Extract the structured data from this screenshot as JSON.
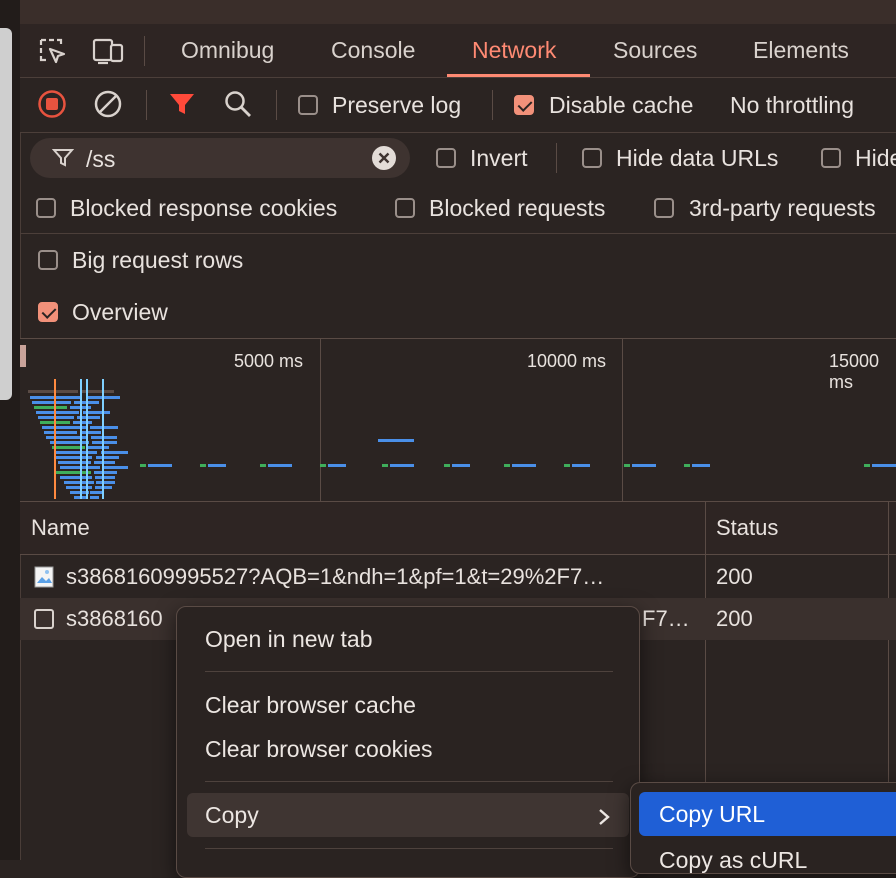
{
  "tabs": [
    {
      "label": "Omnibug",
      "active": false
    },
    {
      "label": "Console",
      "active": false
    },
    {
      "label": "Network",
      "active": true
    },
    {
      "label": "Sources",
      "active": false
    },
    {
      "label": "Elements",
      "active": false
    }
  ],
  "toolbar": {
    "preserve_log": {
      "label": "Preserve log",
      "checked": false
    },
    "disable_cache": {
      "label": "Disable cache",
      "checked": true
    },
    "throttling": "No throttling"
  },
  "filter": {
    "value": "/ss",
    "invert": {
      "label": "Invert",
      "checked": false
    },
    "hide_data_urls": {
      "label": "Hide data URLs",
      "checked": false
    },
    "hide_ext": {
      "label": "Hide",
      "checked": false
    },
    "blocked_cookies": {
      "label": "Blocked response cookies",
      "checked": false
    },
    "blocked_requests": {
      "label": "Blocked requests",
      "checked": false
    },
    "third_party": {
      "label": "3rd-party requests",
      "checked": false
    }
  },
  "settings": {
    "big_rows": {
      "label": "Big request rows",
      "checked": false
    },
    "overview": {
      "label": "Overview",
      "checked": true
    }
  },
  "overview_ticks": [
    "5000 ms",
    "10000 ms",
    "15000 ms"
  ],
  "table": {
    "headers": {
      "name": "Name",
      "status": "Status"
    },
    "rows": [
      {
        "name": "s38681609995527?AQB=1&ndh=1&pf=1&t=29%2F7…",
        "status": "200"
      },
      {
        "name": "s3868160",
        "name_tail": "F7…",
        "status": "200"
      }
    ]
  },
  "context_menu": {
    "items": [
      "Open in new tab",
      "Clear browser cache",
      "Clear browser cookies",
      "Copy"
    ],
    "submenu": [
      "Copy URL",
      "Copy as cURL"
    ]
  },
  "colors": {
    "accent": "#ff8a73",
    "record": "#e8533f",
    "menu_highlight": "#1f5fd6",
    "bar_blue": "#4a8fe8",
    "bar_green": "#3fae5b"
  }
}
